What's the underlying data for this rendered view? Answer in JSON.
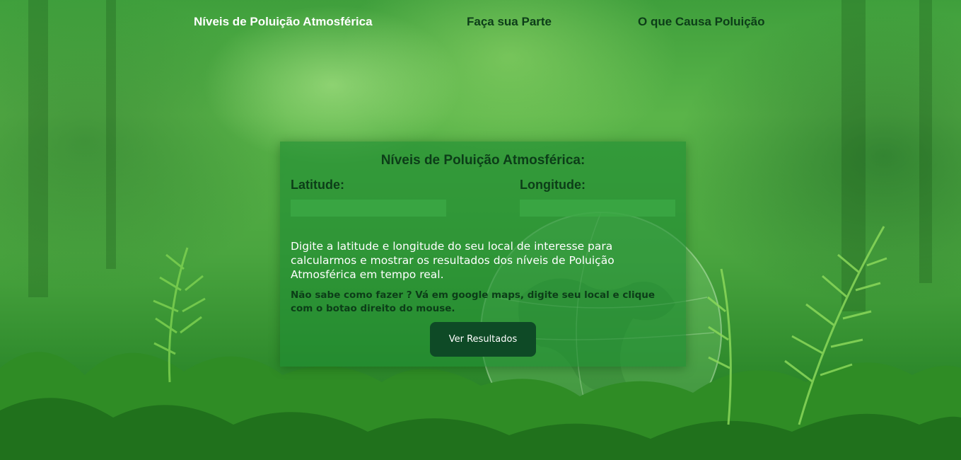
{
  "nav": {
    "links": [
      {
        "label": "Níveis de Poluição Atmosférica",
        "active": true
      },
      {
        "label": "Faça sua Parte",
        "active": false
      },
      {
        "label": "O que Causa Poluição",
        "active": false
      }
    ]
  },
  "card": {
    "title": "Níveis de Poluição Atmosférica:",
    "latitude_label": "Latitude:",
    "latitude_value": "",
    "longitude_label": "Longitude:",
    "longitude_value": "",
    "description": "Digite a latitude e longitude do seu local de interesse para calcularmos e mostrar os resultados dos níveis de Poluição Atmosférica em tempo real.",
    "hint": "Não sabe como fazer ? Vá em google maps, digite seu local e clique com o botao direito do mouse.",
    "button_label": "Ver Resultados"
  },
  "colors": {
    "nav_text": "#0c3d18",
    "nav_active": "#ffffff",
    "card_bg": "#1e8c32",
    "button_bg": "#0e4a26"
  }
}
